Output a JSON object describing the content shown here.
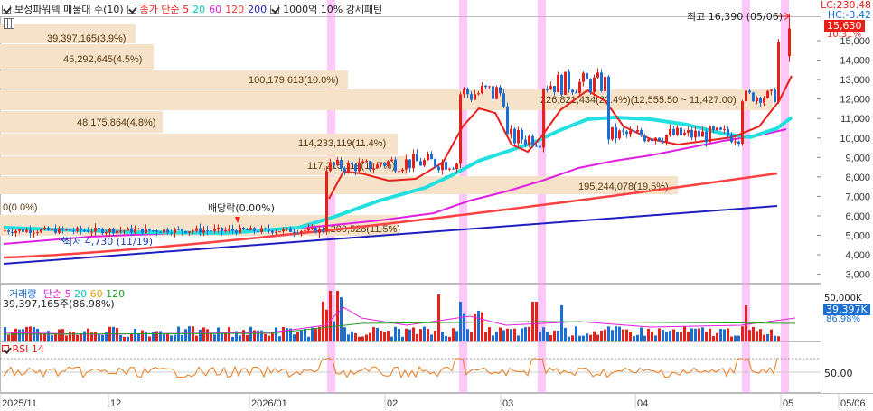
{
  "legend": {
    "stock": "보성파워텍 매물대 수(10)",
    "price_label": "종가 단순 5",
    "ma": [
      "20",
      "60",
      "120",
      "200"
    ],
    "ma_colors": [
      "#00d0d0",
      "#e020e0",
      "#ff4040",
      "#2020c0"
    ],
    "extra": "1000억 10% 강세패턴"
  },
  "corner": {
    "lc": "LC:230.48",
    "hc": "HC:-3.42",
    "pct": "10.31%"
  },
  "price_axis": [
    "15,000",
    "14,000",
    "13,000",
    "12,000",
    "11,000",
    "10,000",
    "9,000",
    "8,000",
    "7,000",
    "6,000",
    "5,000",
    "4,000",
    "3,000"
  ],
  "current_price": "15,630",
  "high_note": "최고 16,390 (05/06)",
  "low_note": "최저 4,730 (11/19)",
  "dividend_note": "배당락(0.00%)",
  "bands": [
    {
      "label": "39,397,165(3.9%)"
    },
    {
      "label": "45,292,645(4.5%)"
    },
    {
      "label": "100,179,613(10.0%)"
    },
    {
      "label": "226,821,434(22.4%)(12,555.50 ~ 11,427.00)"
    },
    {
      "label": "48,175,864(4.8%)"
    },
    {
      "label": "114,233,119(11.4%)"
    },
    {
      "label": "117,215,119(11.7%)"
    },
    {
      "label": "195,244,078(19.5%)"
    },
    {
      "label": "0(0.0%)"
    },
    {
      "label": "116,200,528(11.5%)"
    }
  ],
  "volume": {
    "title": "거래량",
    "ma_label": "단순 5",
    "ma": [
      "20",
      "60",
      "120"
    ],
    "readout": "39,397,165주(86.98%)",
    "axis_top": "50,000K",
    "current": "39,397K",
    "current_pct": "86.98%"
  },
  "rsi": {
    "title": "RSI 14",
    "axis": "50.00"
  },
  "x_axis": [
    "2025/11",
    "12",
    "2026/01",
    "02",
    "03",
    "04",
    "05",
    "05/06"
  ],
  "colors": {
    "up": "#e8201a",
    "down": "#1a6fd6",
    "band": "#f5e2c9",
    "highlight": "#ff9bf5"
  }
}
